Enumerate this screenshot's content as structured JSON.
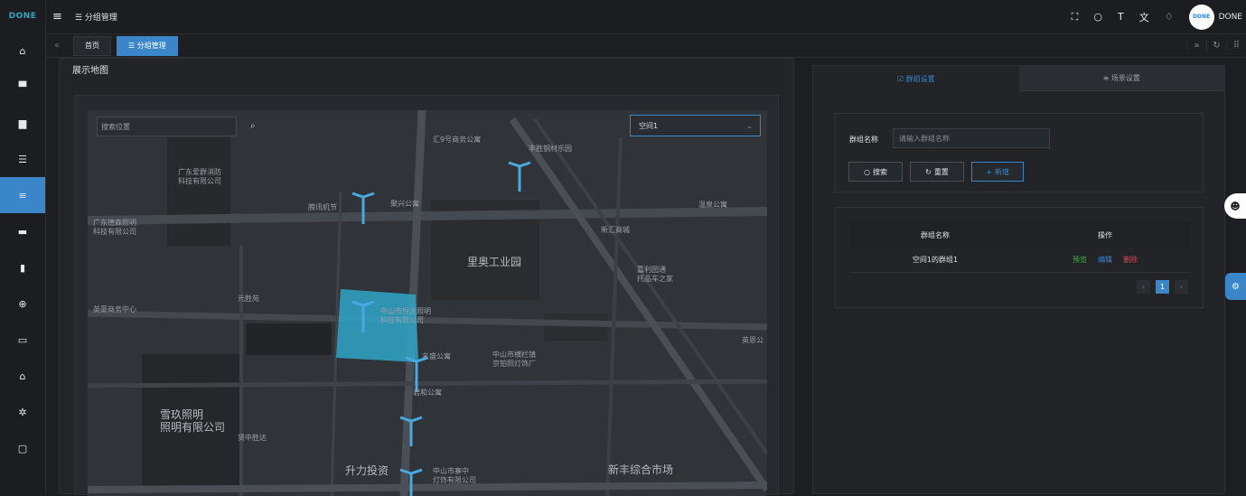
{
  "app": {
    "logo": "DONE"
  },
  "sidebar": {
    "items": [
      {
        "icon": "home-icon",
        "glyph": "⌂"
      },
      {
        "icon": "monitor-icon",
        "glyph": "▀"
      },
      {
        "icon": "cabinet-icon",
        "glyph": "▆"
      },
      {
        "icon": "sliders-icon",
        "glyph": "☰"
      },
      {
        "icon": "list-icon",
        "glyph": "≡"
      },
      {
        "icon": "chat-icon",
        "glyph": "▬"
      },
      {
        "icon": "bar-chart-icon",
        "glyph": "▮"
      },
      {
        "icon": "globe-icon",
        "glyph": "⊕"
      },
      {
        "icon": "calendar-icon",
        "glyph": "▭"
      },
      {
        "icon": "house-icon",
        "glyph": "⌂"
      },
      {
        "icon": "settings-icon",
        "glyph": "✲"
      },
      {
        "icon": "display-icon",
        "glyph": "▢"
      }
    ]
  },
  "header": {
    "menu_glyph": "≡",
    "breadcrumb": "☰ 分组管理",
    "username": "DONE",
    "avatar_text": "DONE"
  },
  "tabs": [
    {
      "label": "首页"
    },
    {
      "label": "☰ 分组管理"
    }
  ],
  "left_panel": {
    "title": "展示地图",
    "map": {
      "search_placeholder": "搜索位置",
      "select_value": "空间1",
      "labels": [
        {
          "text": "汇9号商务公寓"
        },
        {
          "text": "丰胜钢材乐园"
        },
        {
          "text": "广东爱群消防\n科技有限公司"
        },
        {
          "text": "腾讯机节"
        },
        {
          "text": "聚兴公寓"
        },
        {
          "text": "温泉公寓"
        },
        {
          "text": "广东德森照明\n科技有限公司"
        },
        {
          "text": "新汇商城"
        },
        {
          "text": "里奥工业园",
          "big": true
        },
        {
          "text": "嘉利园通\n托品车之家"
        },
        {
          "text": "英豪商务中心"
        },
        {
          "text": "元胜苑"
        },
        {
          "text": "中山市恒光照明\n科技有限公司"
        },
        {
          "text": "名盛公寓"
        },
        {
          "text": "中山市横栏镇\n京铂照灯饰厂"
        },
        {
          "text": "君和公寓"
        },
        {
          "text": "雪玖照明\n照明有限公司",
          "big": true
        },
        {
          "text": "贤中胜达"
        },
        {
          "text": "升力投资",
          "big": true
        },
        {
          "text": "中山市寨中\n灯饰有限公司"
        },
        {
          "text": "新丰综合市场",
          "big": true
        },
        {
          "text": "英恩公"
        }
      ]
    }
  },
  "right_panel": {
    "tabs": [
      {
        "label": "☑ 群组设置"
      },
      {
        "label": "≡ 场景设置"
      }
    ],
    "search": {
      "label": "群组名称",
      "placeholder": "请输入群组名称",
      "search_btn": "搜索",
      "reset_btn": "重置",
      "add_btn": "新增"
    },
    "table": {
      "headers": [
        "群组名称",
        "操作"
      ],
      "rows": [
        {
          "name": "空间1的群组1",
          "preview": "预览",
          "edit": "编辑",
          "delete": "删除"
        }
      ]
    },
    "pager": {
      "prev": "‹",
      "current": "1",
      "next": "›"
    }
  },
  "colors": {
    "accent": "#3a86c8",
    "highlight": "#2fa5c8",
    "preview": "#47b04b",
    "delete": "#e0474c"
  }
}
